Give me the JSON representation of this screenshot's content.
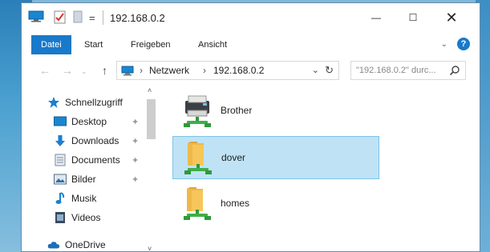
{
  "window": {
    "title": "192.168.0.2",
    "quick_access_separator": "=",
    "controls": {
      "minimize": "—",
      "maximize": "☐",
      "close": "✕"
    }
  },
  "ribbon": {
    "tabs": [
      "Datei",
      "Start",
      "Freigeben",
      "Ansicht"
    ],
    "expand": "⌄",
    "help": "?"
  },
  "address": {
    "back": "←",
    "forward": "→",
    "recent": "⌄",
    "up": "↑",
    "separator": "›",
    "segments": [
      "Netzwerk",
      "192.168.0.2"
    ],
    "dropdown": "⌄",
    "refresh": "↻"
  },
  "search": {
    "placeholder": "\"192.168.0.2\" durc..."
  },
  "nav_pane": {
    "items": [
      {
        "label": "Schnellzugriff",
        "icon": "star-icon"
      },
      {
        "label": "Desktop",
        "icon": "desktop-folder-icon",
        "pinned": true
      },
      {
        "label": "Downloads",
        "icon": "download-icon",
        "pinned": true
      },
      {
        "label": "Documents",
        "icon": "documents-icon",
        "pinned": true
      },
      {
        "label": "Bilder",
        "icon": "pictures-icon",
        "pinned": true
      },
      {
        "label": "Musik",
        "icon": "music-icon"
      },
      {
        "label": "Videos",
        "icon": "videos-icon"
      },
      {
        "label": "OneDrive",
        "icon": "onedrive-icon"
      }
    ],
    "pin_glyph": "✦",
    "scroll_up": "˄",
    "scroll_down": "˅"
  },
  "content": {
    "items": [
      {
        "label": "Brother",
        "icon": "network-printer-icon",
        "selected": false
      },
      {
        "label": "dover",
        "icon": "network-share-folder-icon",
        "selected": true
      },
      {
        "label": "homes",
        "icon": "network-share-folder-icon",
        "selected": false
      }
    ]
  },
  "colors": {
    "accent": "#1979ca",
    "selection": "#bfe3f5",
    "selection_border": "#7ec3e8"
  }
}
